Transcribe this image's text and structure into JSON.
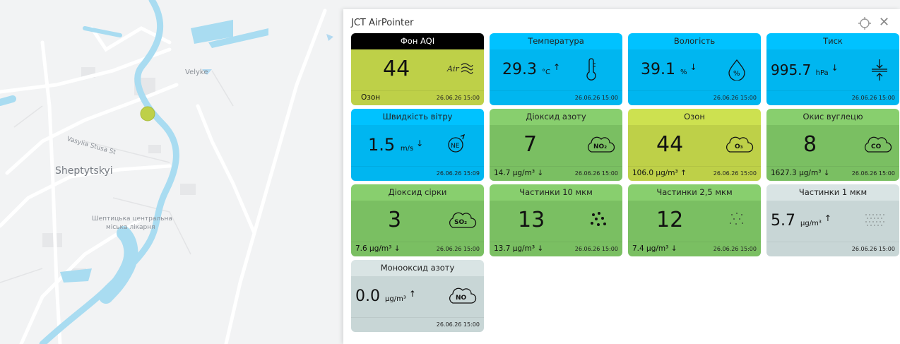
{
  "panel": {
    "title": "JCT AirPointer",
    "locate_icon": "crosshair-icon",
    "close_icon": "close-icon"
  },
  "map": {
    "labels": {
      "velyke": "Velyke",
      "street": "Vasylia Stusa St",
      "city": "Sheptytskyi",
      "hospital_line1": "Шептицька центральна",
      "hospital_line2": "міська лікарня"
    },
    "marker_color": "#bed048"
  },
  "colors": {
    "lime": "#bed048",
    "blue": "#00b6f0",
    "green": "#7abf62",
    "grey": "#c8d6d6",
    "black": "#000000"
  },
  "cards": {
    "aqi": {
      "header": "Фон AQI",
      "value": "44",
      "sub": "Озон",
      "date": "26.06.26 15:00",
      "icon": "air-waves-icon"
    },
    "temp": {
      "header": "Температура",
      "value": "29.3",
      "unit": "°C",
      "arrow": "↑",
      "date": "26.06.26 15:00",
      "icon": "thermometer-icon"
    },
    "hum": {
      "header": "Вологість",
      "value": "39.1",
      "unit": "%",
      "arrow": "↓",
      "date": "26.06.26 15:00",
      "icon": "humidity-drop-icon"
    },
    "press": {
      "header": "Тиск",
      "value": "995.7",
      "unit": "hPa",
      "arrow": "↓",
      "date": "26.06.26 15:00",
      "icon": "pressure-icon"
    },
    "wind": {
      "header": "Швидкість вітру",
      "value": "1.5",
      "unit": "m/s",
      "arrow": "↓",
      "date": "26.06.26 15:09",
      "icon": "wind-direction-icon",
      "dir": "NE"
    },
    "no2": {
      "header": "Діоксид азоту",
      "value": "7",
      "sub": "14.7 μg/m³",
      "arrow": "↓",
      "date": "26.06.26 15:00",
      "icon": "no2-cloud-icon",
      "chem": "NO₂"
    },
    "o3": {
      "header": "Озон",
      "value": "44",
      "sub": "106.0 μg/m³",
      "arrow": "↑",
      "date": "26.06.26 15:00",
      "icon": "o3-cloud-icon",
      "chem": "O₃"
    },
    "co": {
      "header": "Окис вуглецю",
      "value": "8",
      "sub": "1627.3 μg/m³",
      "arrow": "↓",
      "date": "26.06.26 15:00",
      "icon": "co-cloud-icon",
      "chem": "CO"
    },
    "so2": {
      "header": "Діоксид сірки",
      "value": "3",
      "sub": "7.6 μg/m³",
      "arrow": "↓",
      "date": "26.06.26 15:00",
      "icon": "so2-cloud-icon",
      "chem": "SO₂"
    },
    "pm10": {
      "header": "Частинки 10 мкм",
      "value": "13",
      "sub": "13.7 μg/m³",
      "arrow": "↓",
      "date": "26.06.26 15:00",
      "icon": "pm10-dots-icon"
    },
    "pm25": {
      "header": "Частинки 2,5 мкм",
      "value": "12",
      "sub": "7.4 μg/m³",
      "arrow": "↓",
      "date": "26.06.26 15:00",
      "icon": "pm25-dots-icon"
    },
    "pm1": {
      "header": "Частинки 1 мкм",
      "value": "5.7",
      "unit": "μg/m³",
      "arrow": "↑",
      "date": "26.06.26 15:00",
      "icon": "pm1-dots-icon"
    },
    "no": {
      "header": "Монооксид азоту",
      "value": "0.0",
      "unit": "μg/m³",
      "arrow": "↑",
      "date": "26.06.26 15:00",
      "icon": "no-cloud-icon",
      "chem": "NO"
    }
  }
}
